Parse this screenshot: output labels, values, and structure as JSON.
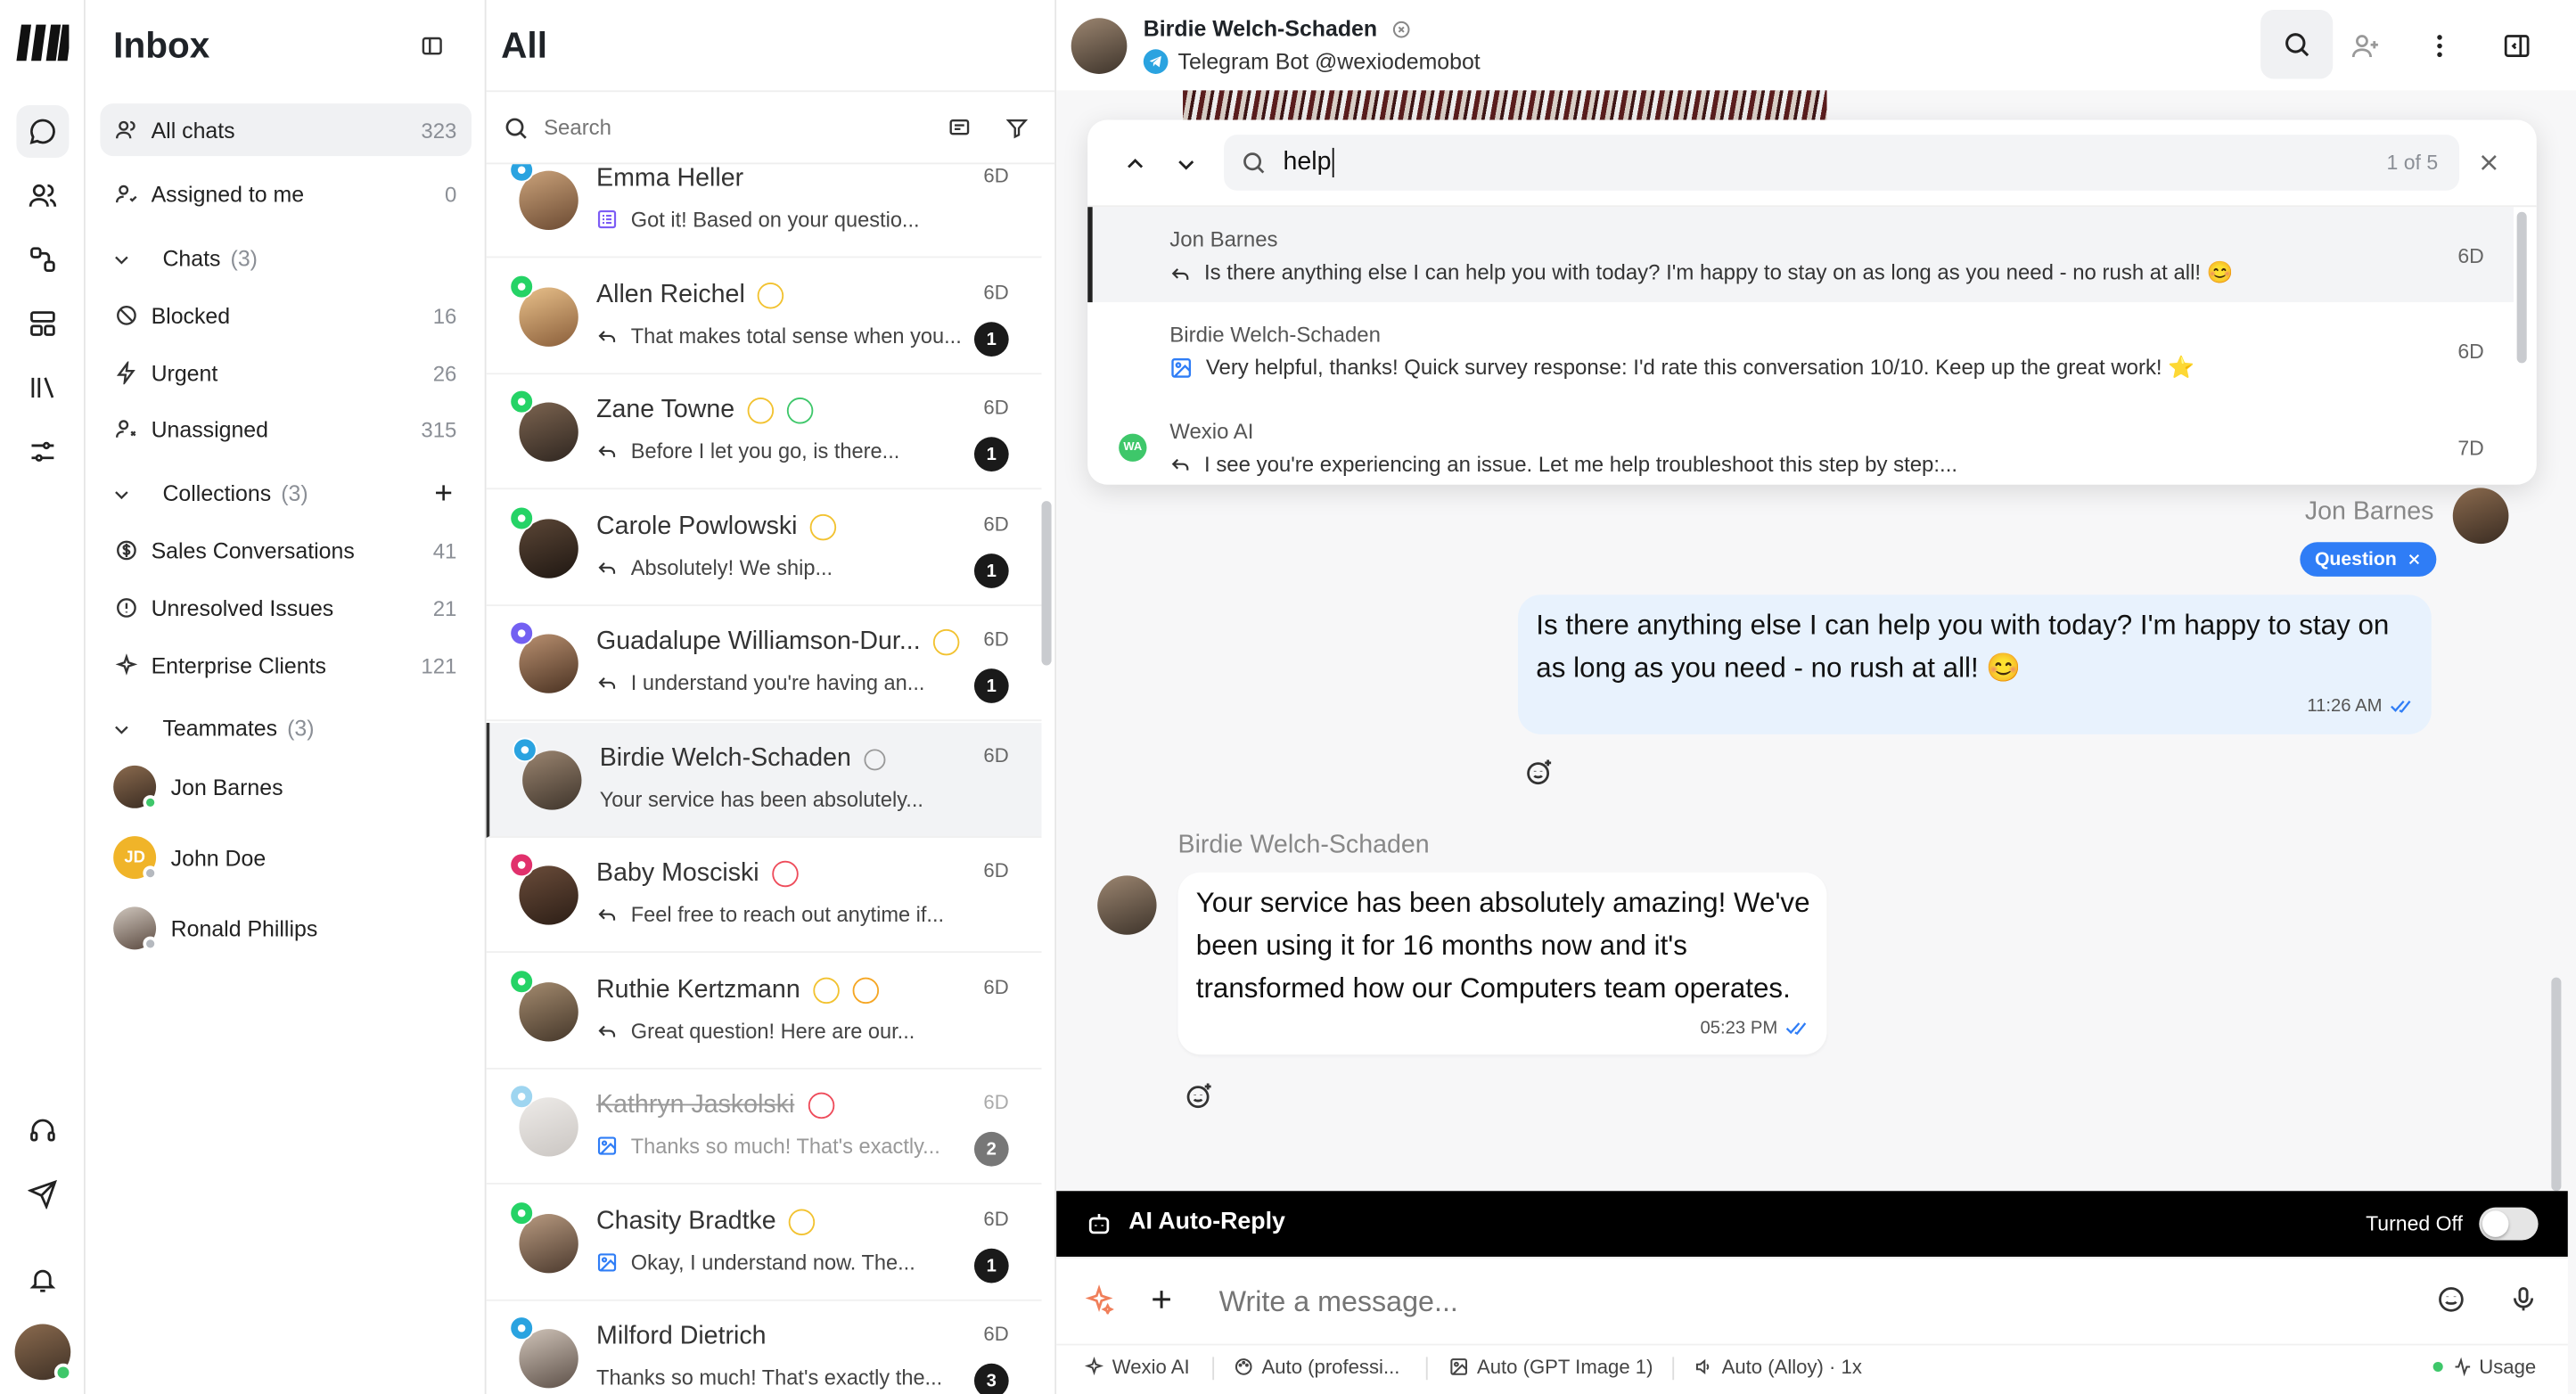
{
  "colors": {
    "accent": "#2f7df6",
    "active_bg": "#f0f1f3",
    "tag_bg": "#2f7df6",
    "badge": "#1a1a1a",
    "whatsapp": "#25d366",
    "telegram": "#2aa3e0",
    "instagram": "#e1306c",
    "viber": "#7360f2",
    "pending": "#f2c230",
    "resolved": "#3ec76a",
    "blocked": "#ee4b5a",
    "urgent": "#f5a623"
  },
  "rail": {
    "icons": [
      "logo-icon",
      "chat-bubble-icon",
      "contacts-icon",
      "workflow-icon",
      "layout-icon",
      "library-icon",
      "sliders-icon",
      "headset-icon",
      "send-icon",
      "bell-icon",
      "user-avatar"
    ]
  },
  "inbox": {
    "title": "Inbox",
    "all_chats": {
      "label": "All chats",
      "count": "323"
    },
    "assigned": {
      "label": "Assigned to me",
      "count": "0"
    },
    "chats": {
      "label": "Chats",
      "count": "(3)"
    },
    "blocked": {
      "label": "Blocked",
      "count": "16"
    },
    "urgent": {
      "label": "Urgent",
      "count": "26"
    },
    "unassigned": {
      "label": "Unassigned",
      "count": "315"
    },
    "collections": {
      "label": "Collections",
      "count": "(3)"
    },
    "sales": {
      "label": "Sales Conversations",
      "count": "41"
    },
    "unresolved": {
      "label": "Unresolved Issues",
      "count": "21"
    },
    "enterprise": {
      "label": "Enterprise Clients",
      "count": "121"
    },
    "teammates": {
      "label": "Teammates",
      "count": "(3)"
    },
    "mates": [
      {
        "name": "Jon Barnes",
        "status": "online"
      },
      {
        "name": "John Doe",
        "initials": "JD",
        "status": "offline"
      },
      {
        "name": "Ronald Phillips",
        "status": "offline"
      }
    ]
  },
  "list": {
    "title": "All",
    "search_placeholder": "Search",
    "rows": [
      {
        "name": "Emma Heller",
        "preview": "Got it! Based on your questio...",
        "time": "6D",
        "channel": "telegram",
        "badge": ""
      },
      {
        "name": "Allen Reichel",
        "preview": "That makes total sense when you...",
        "time": "6D",
        "channel": "whatsapp",
        "badge": "1"
      },
      {
        "name": "Zane Towne",
        "preview": "Before I let you go, is there...",
        "time": "6D",
        "channel": "whatsapp",
        "badge": "1"
      },
      {
        "name": "Carole Powlowski",
        "preview": "Absolutely! We ship...",
        "time": "6D",
        "channel": "whatsapp",
        "badge": "1"
      },
      {
        "name": "Guadalupe Williamson-Dur...",
        "preview": "I understand you're having an...",
        "time": "6D",
        "channel": "viber",
        "badge": "1"
      },
      {
        "name": "Birdie Welch-Schaden",
        "preview": "Your service has been absolutely...",
        "time": "6D",
        "channel": "telegram",
        "badge": ""
      },
      {
        "name": "Baby Mosciski",
        "preview": "Feel free to reach out anytime if...",
        "time": "6D",
        "channel": "instagram",
        "badge": ""
      },
      {
        "name": "Ruthie Kertzmann",
        "preview": "Great question! Here are our...",
        "time": "6D",
        "channel": "whatsapp",
        "badge": ""
      },
      {
        "name": "Kathryn Jaskolski",
        "preview": "Thanks so much! That's exactly...",
        "time": "6D",
        "channel": "telegram",
        "badge": "2"
      },
      {
        "name": "Chasity Bradtke",
        "preview": "Okay, I understand now. The...",
        "time": "6D",
        "channel": "whatsapp",
        "badge": "1"
      },
      {
        "name": "Milford Dietrich",
        "preview": "Thanks so much! That's exactly the...",
        "time": "6D",
        "channel": "telegram",
        "badge": "3"
      }
    ]
  },
  "chat": {
    "contact_name": "Birdie Welch-Schaden",
    "contact_sub": "Telegram Bot @wexiodemobot",
    "search": {
      "query": "help",
      "counter": "1 of 5",
      "results": [
        {
          "name": "Jon Barnes",
          "text": "Is there anything else I can help you with today? I'm happy to stay on as long as you need - no rush at all! 😊",
          "date": "6D"
        },
        {
          "name": "Birdie Welch-Schaden",
          "text": "Very helpful, thanks! Quick survey response: I'd rate this conversation 10/10. Keep up the great work! ⭐",
          "date": "6D"
        },
        {
          "name": "Wexio AI",
          "initials": "WA",
          "text": "I see you're experiencing an issue. Let me help troubleshoot this step by step:...",
          "date": "7D"
        }
      ]
    },
    "agent_name": "Jon Barnes",
    "tag": "Question",
    "out_msg": "Is there anything else I can help you with today? I'm happy to stay on as long as you need - no rush at all! 😊",
    "out_time": "11:26 AM",
    "in_name": "Birdie Welch-Schaden",
    "in_msg": "Your service has been absolutely amazing! We've been using it for 16 months now and it's transformed how our Computers team operates.",
    "in_time": "05:23 PM",
    "auto_reply": {
      "label": "AI Auto-Reply",
      "state": "Turned Off"
    },
    "composer_placeholder": "Write a message...",
    "toolbar": {
      "ai": "Wexio AI",
      "tone": "Auto (professi...",
      "image": "Auto (GPT Image 1)",
      "voice": "Auto (Alloy) · 1x",
      "usage": "Usage"
    }
  }
}
